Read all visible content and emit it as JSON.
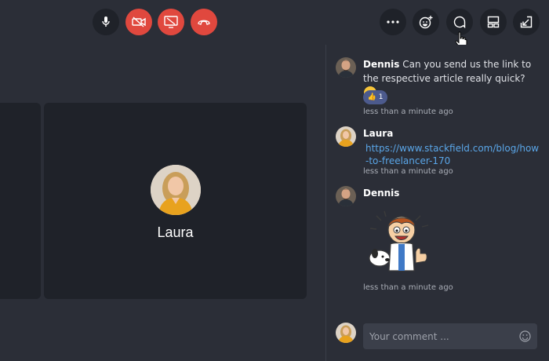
{
  "controls": {
    "center": [
      {
        "name": "microphone-button",
        "icon": "microphone-icon"
      },
      {
        "name": "camera-off-button",
        "icon": "camera-off-icon"
      },
      {
        "name": "screenshare-off-button",
        "icon": "screenshare-off-icon"
      },
      {
        "name": "hangup-button",
        "icon": "phone-hangup-icon"
      }
    ],
    "right": [
      {
        "name": "more-options-button",
        "icon": "ellipsis-icon"
      },
      {
        "name": "add-reaction-button",
        "icon": "emoji-add-icon"
      },
      {
        "name": "chat-button",
        "icon": "chat-bubble-icon"
      },
      {
        "name": "layout-button",
        "icon": "layout-icon"
      },
      {
        "name": "minimize-button",
        "icon": "arrow-down-left-icon"
      }
    ]
  },
  "tiles": [
    {
      "participant": "Laura"
    }
  ],
  "chat": {
    "messages": [
      {
        "author": "Dennis",
        "text": "Can you send us the link to the respective article really quick?",
        "emoji": "confused-face",
        "reaction": {
          "emoji": "thumbs-up",
          "count": "1"
        },
        "time": "less than a minute ago"
      },
      {
        "author": "Laura",
        "link": "https://www.stackfield.com/blog/how-to-freelancer-170",
        "time": "less than a minute ago"
      },
      {
        "author": "Dennis",
        "sticker": "thumbs-up-character-sticker",
        "time": "less than a minute ago"
      }
    ],
    "comment_placeholder": "Your comment ..."
  },
  "colors": {
    "background": "#2b2e37",
    "tile": "#1f2229",
    "danger": "#e0483e",
    "link": "#5aa6e8",
    "reaction": "#4c5a8d"
  }
}
